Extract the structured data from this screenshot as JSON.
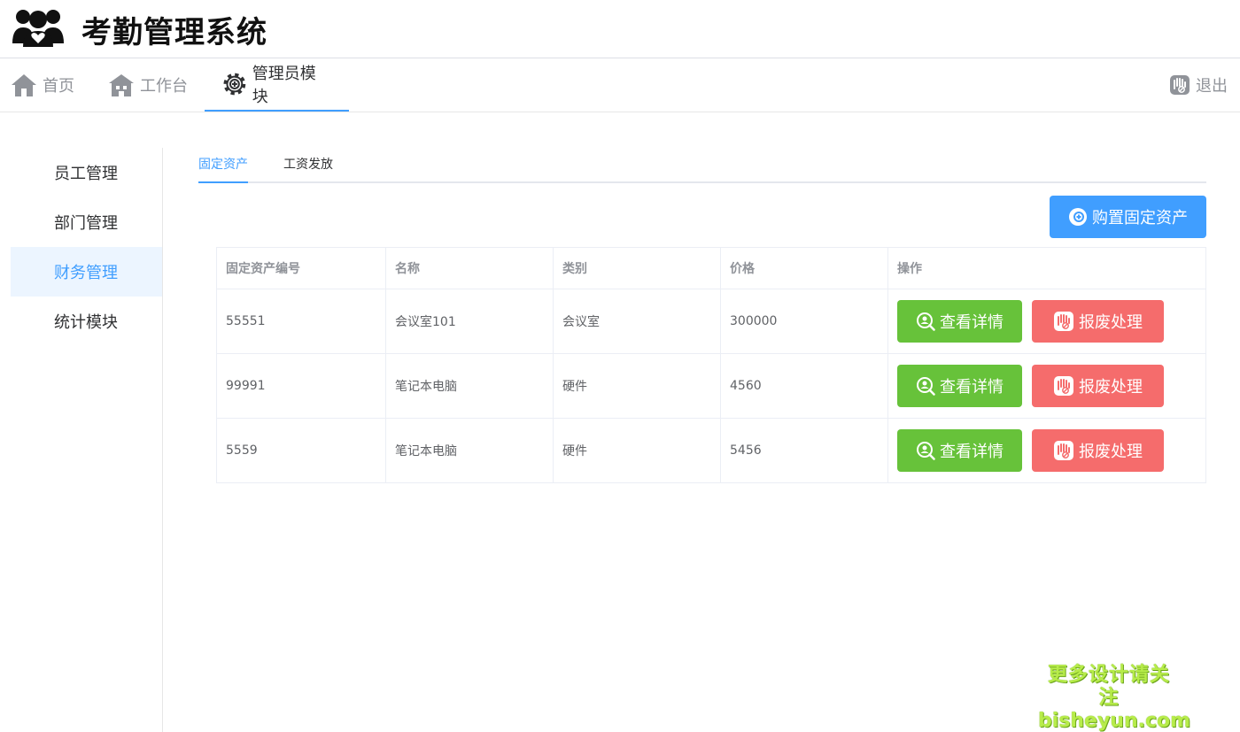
{
  "app": {
    "title": "考勤管理系统"
  },
  "topnav": {
    "home": "首页",
    "workbench": "工作台",
    "admin": "管理员模块",
    "logout": "退出"
  },
  "sidebar": {
    "items": [
      {
        "label": "员工管理"
      },
      {
        "label": "部门管理"
      },
      {
        "label": "财务管理"
      },
      {
        "label": "统计模块"
      }
    ]
  },
  "tabs": [
    {
      "label": "固定资产"
    },
    {
      "label": "工资发放"
    }
  ],
  "actions": {
    "buy": "购置固定资产"
  },
  "table": {
    "headers": [
      "固定资产编号",
      "名称",
      "类别",
      "价格",
      "操作"
    ],
    "rows": [
      {
        "id": "55551",
        "name": "会议室101",
        "category": "会议室",
        "price": "300000"
      },
      {
        "id": "99991",
        "name": "笔记本电脑",
        "category": "硬件",
        "price": "4560"
      },
      {
        "id": "5559",
        "name": "笔记本电脑",
        "category": "硬件",
        "price": "5456"
      }
    ],
    "view_label": "查看详情",
    "scrap_label": "报废处理"
  },
  "watermark": {
    "line1": "更多设计请关注",
    "line2": "bisheyun.com"
  },
  "colors": {
    "primary": "#409eff",
    "success": "#67c23a",
    "danger": "#f56c6c"
  }
}
